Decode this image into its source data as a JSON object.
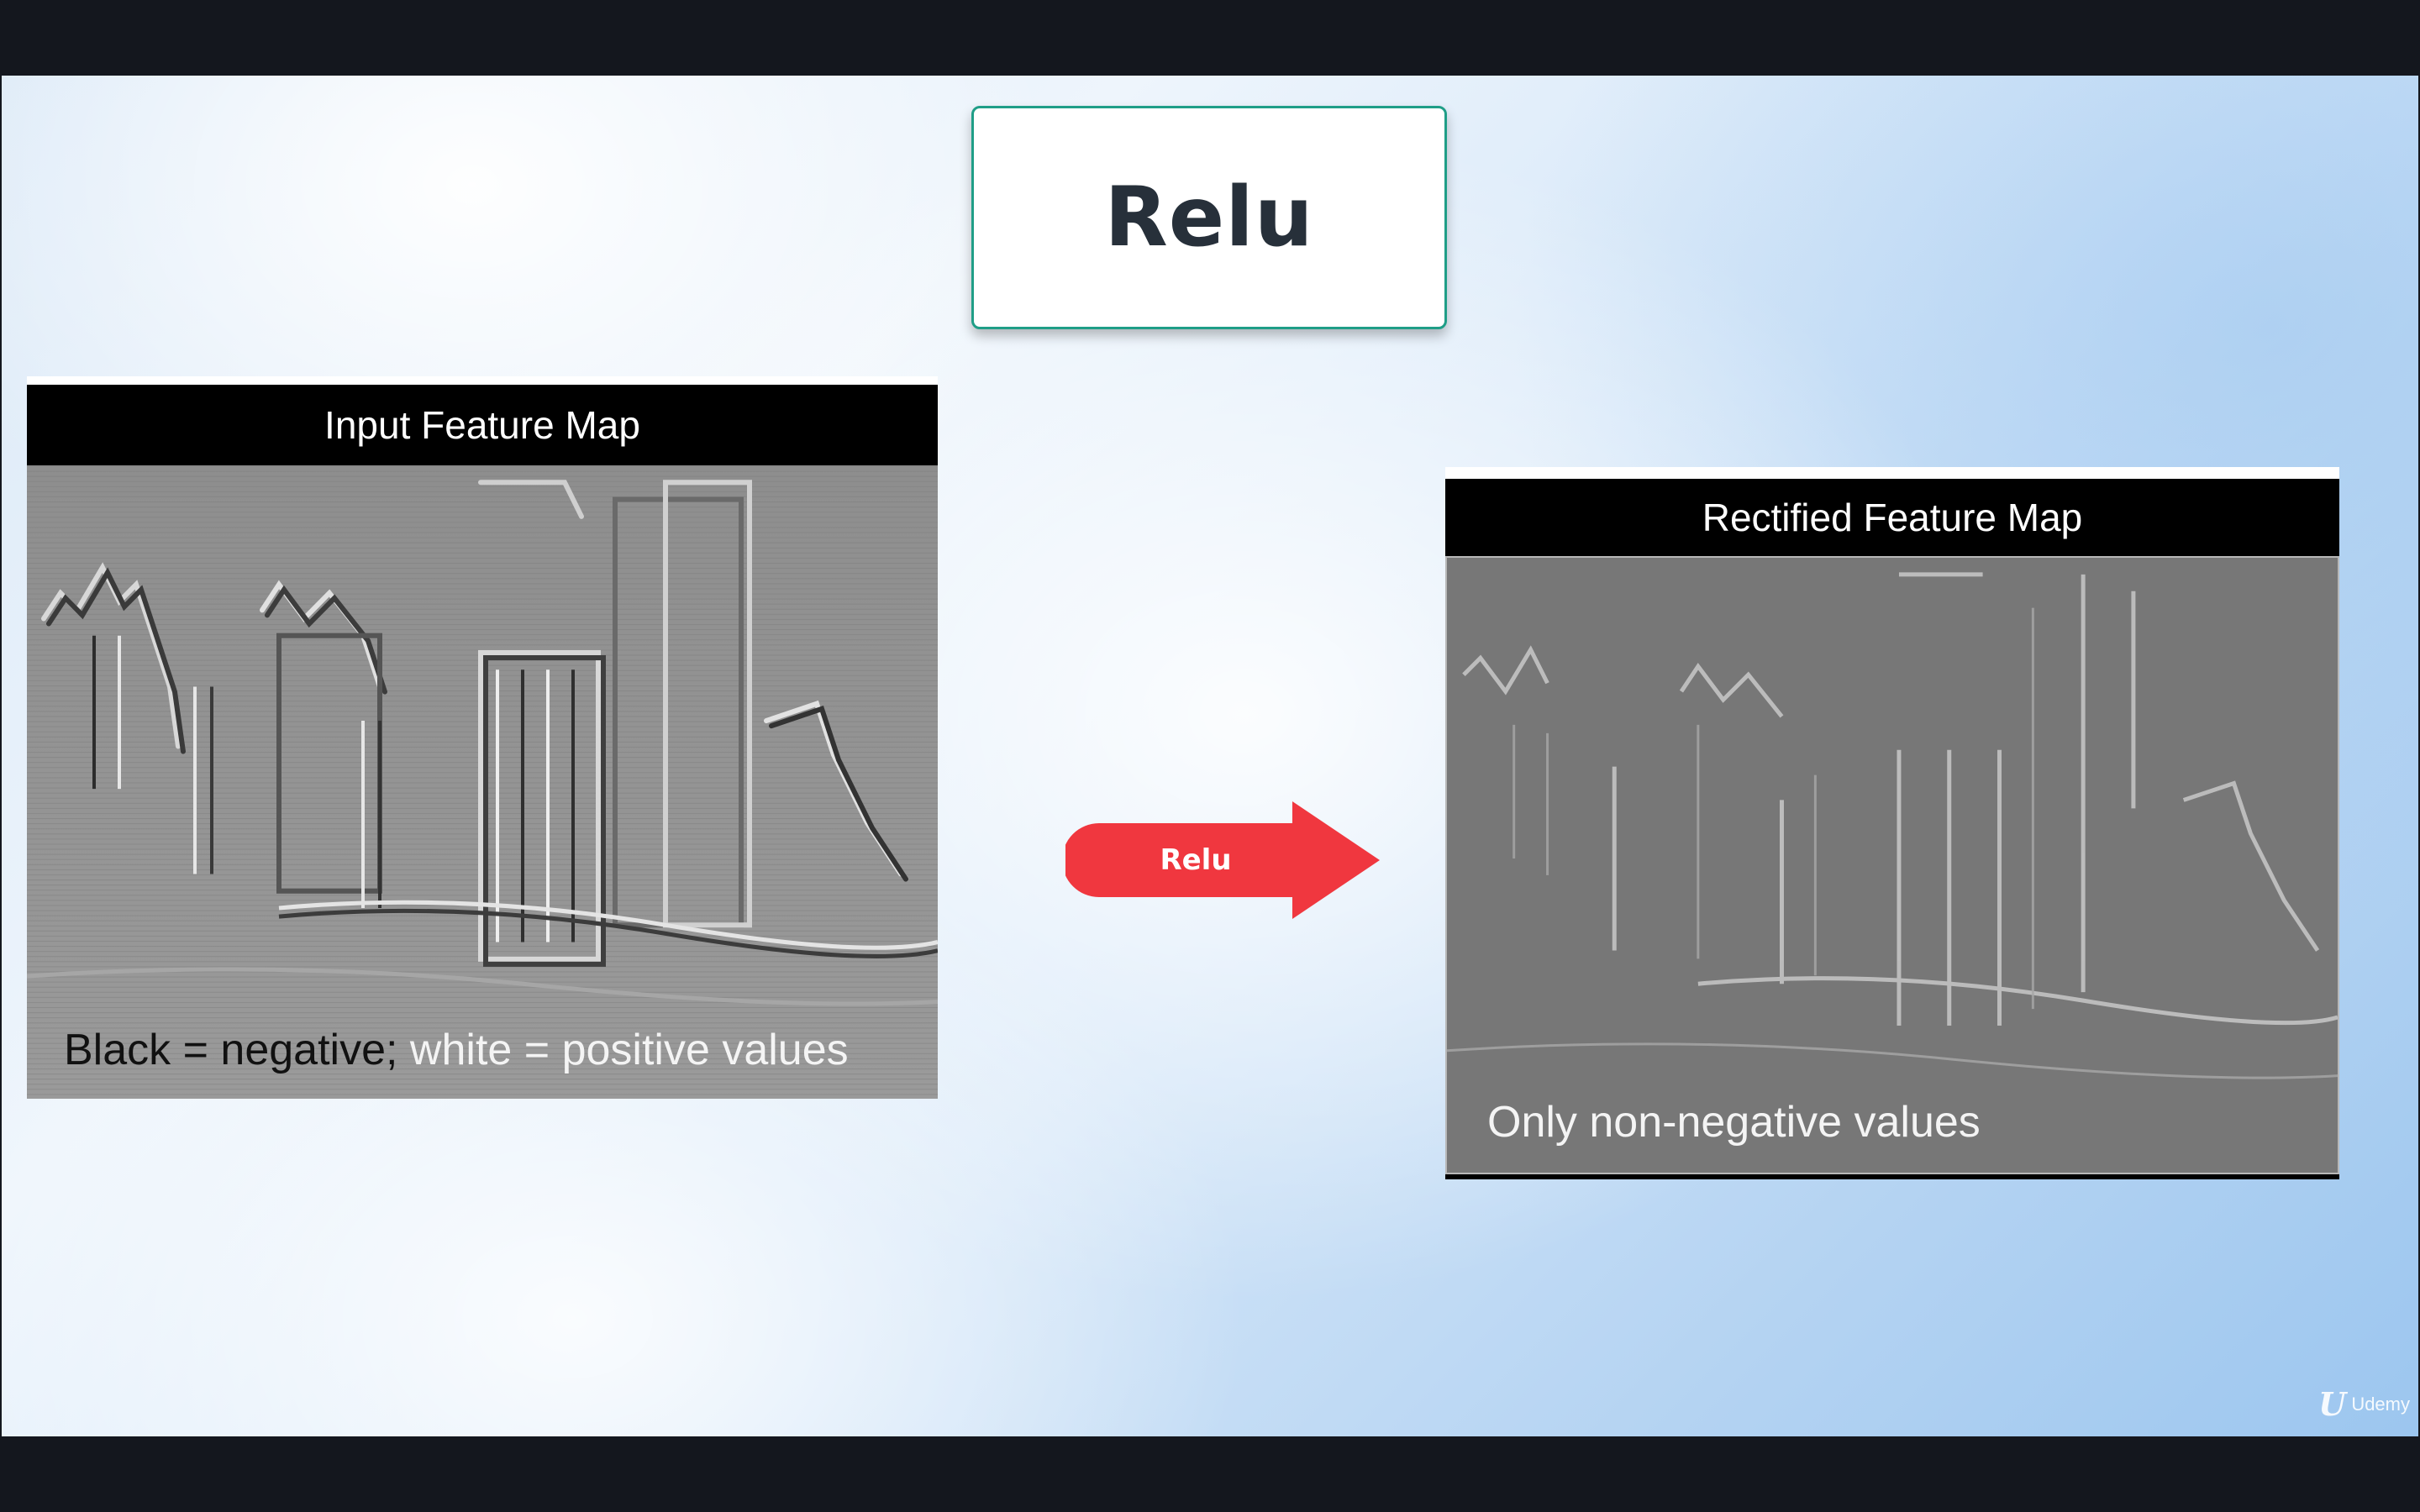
{
  "slide": {
    "title": "Relu"
  },
  "left_panel": {
    "header": "Input Feature Map",
    "caption_dark": "Black = negative;",
    "caption_light": "white = positive values"
  },
  "right_panel": {
    "header": "Rectified Feature Map",
    "caption": "Only non-negative values"
  },
  "arrow": {
    "label": "Relu",
    "color": "#f0373f"
  },
  "watermark": {
    "mark": "U",
    "text": "Udemy"
  },
  "colors": {
    "title_border": "#1f9e87",
    "title_text": "#27303a",
    "letterbox": "#14171e"
  }
}
